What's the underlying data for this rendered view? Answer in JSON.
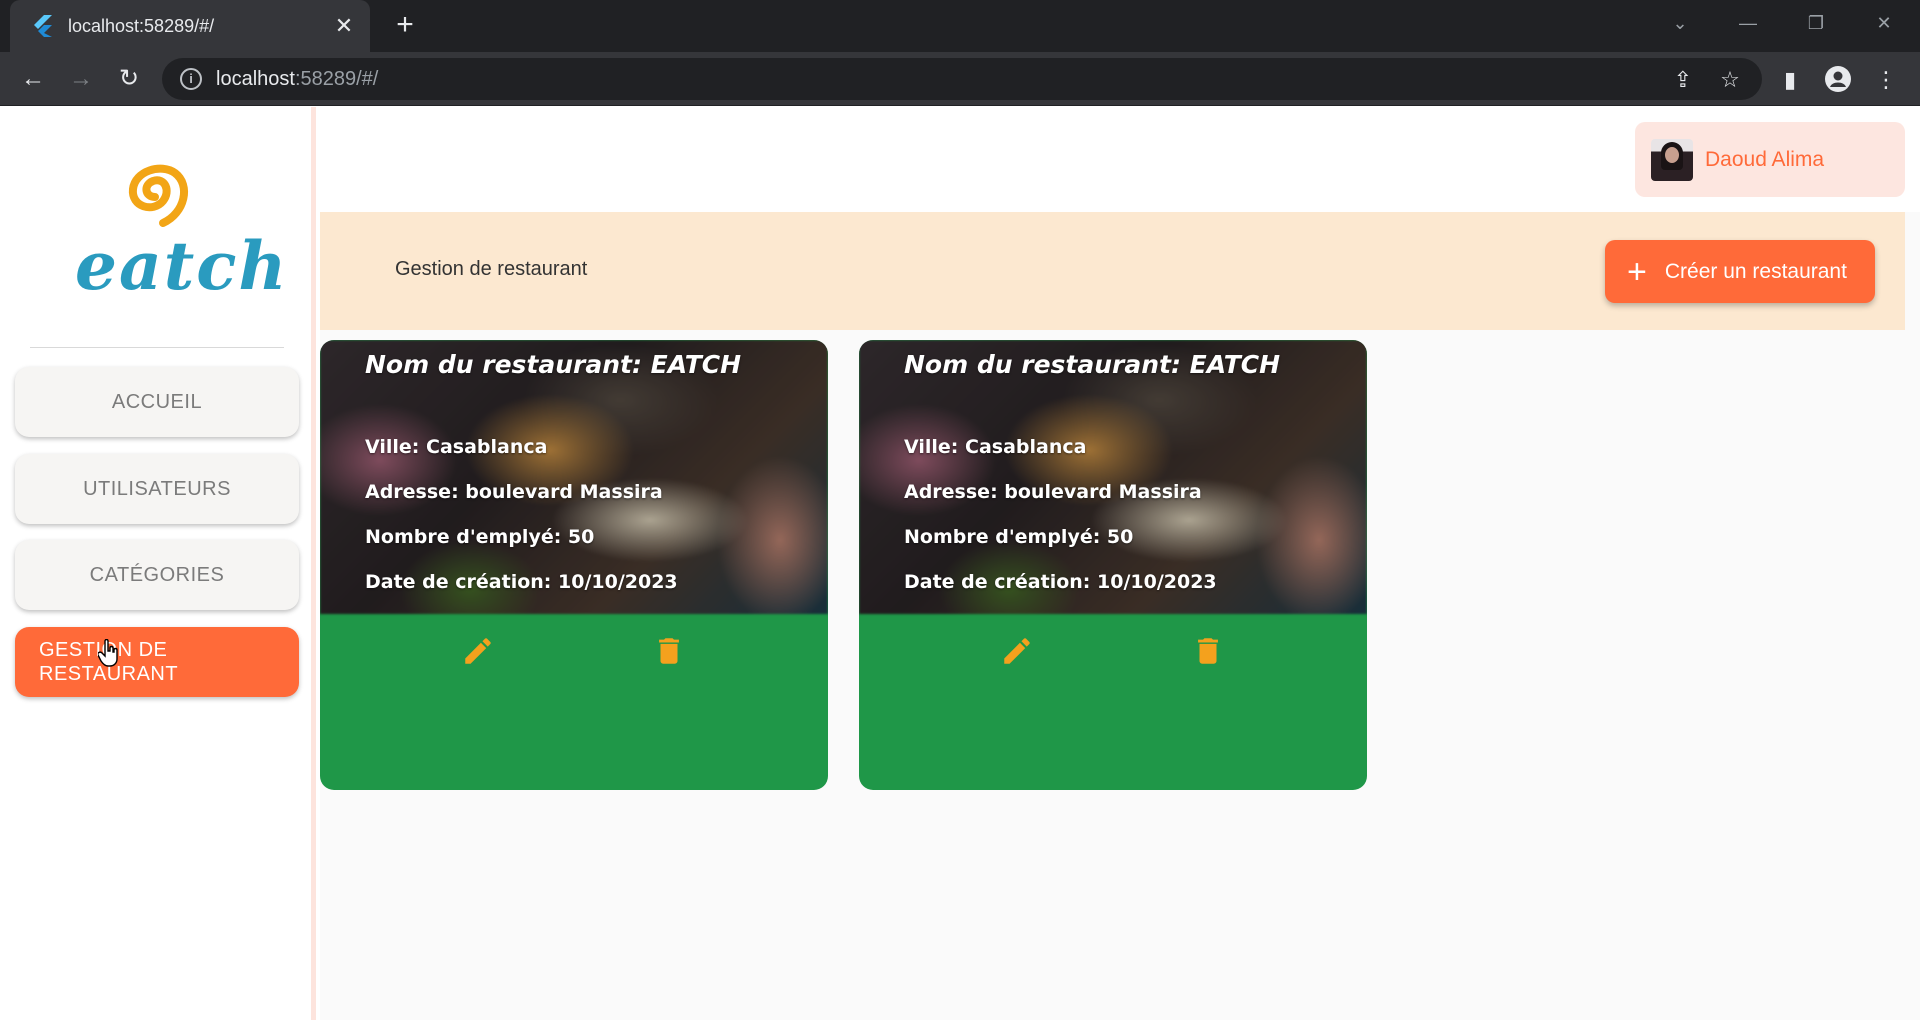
{
  "browser": {
    "tab_title": "localhost:58289/#/",
    "url_host": "localhost",
    "url_path": ":58289/#/"
  },
  "sidebar": {
    "logo_text": "eatch",
    "items": [
      {
        "label": "ACCUEIL"
      },
      {
        "label": "UTILISATEURS"
      },
      {
        "label": "CATÉGORIES"
      },
      {
        "label": "GESTION DE RESTAURANT",
        "active": true
      }
    ]
  },
  "header": {
    "user_name": "Daoud Alima"
  },
  "subheader": {
    "title": "Gestion de restaurant",
    "create_button": "Créer un restaurant"
  },
  "restaurants": [
    {
      "name": "Nom du restaurant: EATCH",
      "city": "Ville: Casablanca",
      "address": "Adresse: boulevard Massira",
      "employees": "Nombre d'emplyé: 50",
      "created": "Date de création: 10/10/2023"
    },
    {
      "name": "Nom du restaurant: EATCH",
      "city": "Ville: Casablanca",
      "address": "Adresse: boulevard Massira",
      "employees": "Nombre d'emplyé: 50",
      "created": "Date de création: 10/10/2023"
    }
  ],
  "colors": {
    "accent": "#ff6a39",
    "card_action_bg": "#1f9748",
    "action_icon": "#f4a11d",
    "subheader_bg": "#fce8d0"
  }
}
